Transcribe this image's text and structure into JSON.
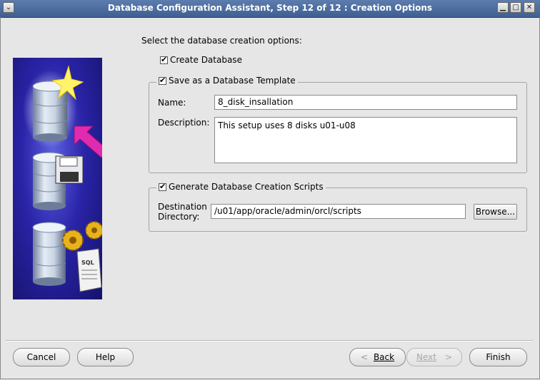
{
  "window": {
    "title": "Database Configuration Assistant, Step 12 of 12 : Creation Options",
    "menu_icon": "chevron-down-icon",
    "minimize_icon": "minimize-icon",
    "maximize_icon": "maximize-icon",
    "close_icon": "close-icon"
  },
  "main": {
    "prompt": "Select the database creation options:",
    "create_database": {
      "label": "Create Database",
      "checked": true
    },
    "template_group": {
      "label": "Save as a Database Template",
      "checked": true,
      "name_label": "Name:",
      "name_value": "8_disk_insallation",
      "description_label": "Description:",
      "description_value": "This setup uses 8 disks u01-u08"
    },
    "scripts_group": {
      "label": "Generate Database Creation Scripts",
      "checked": true,
      "dir_label_line1": "Destination",
      "dir_label_line2": "Directory:",
      "dir_value": "/u01/app/oracle/admin/orcl/scripts",
      "browse_label": "Browse..."
    }
  },
  "footer": {
    "cancel": "Cancel",
    "help": "Help",
    "back": "Back",
    "next": "Next",
    "finish": "Finish",
    "back_icon": "chevron-left-icon",
    "next_icon": "chevron-right-icon"
  },
  "illustration": {
    "sql_label": "SQL"
  },
  "colors": {
    "titlebar": "#4a6a9c",
    "panel": "#e6e6e6",
    "illustration_bg": "#2a24a8",
    "arrow": "#e02bb0",
    "star": "#fff36a"
  }
}
